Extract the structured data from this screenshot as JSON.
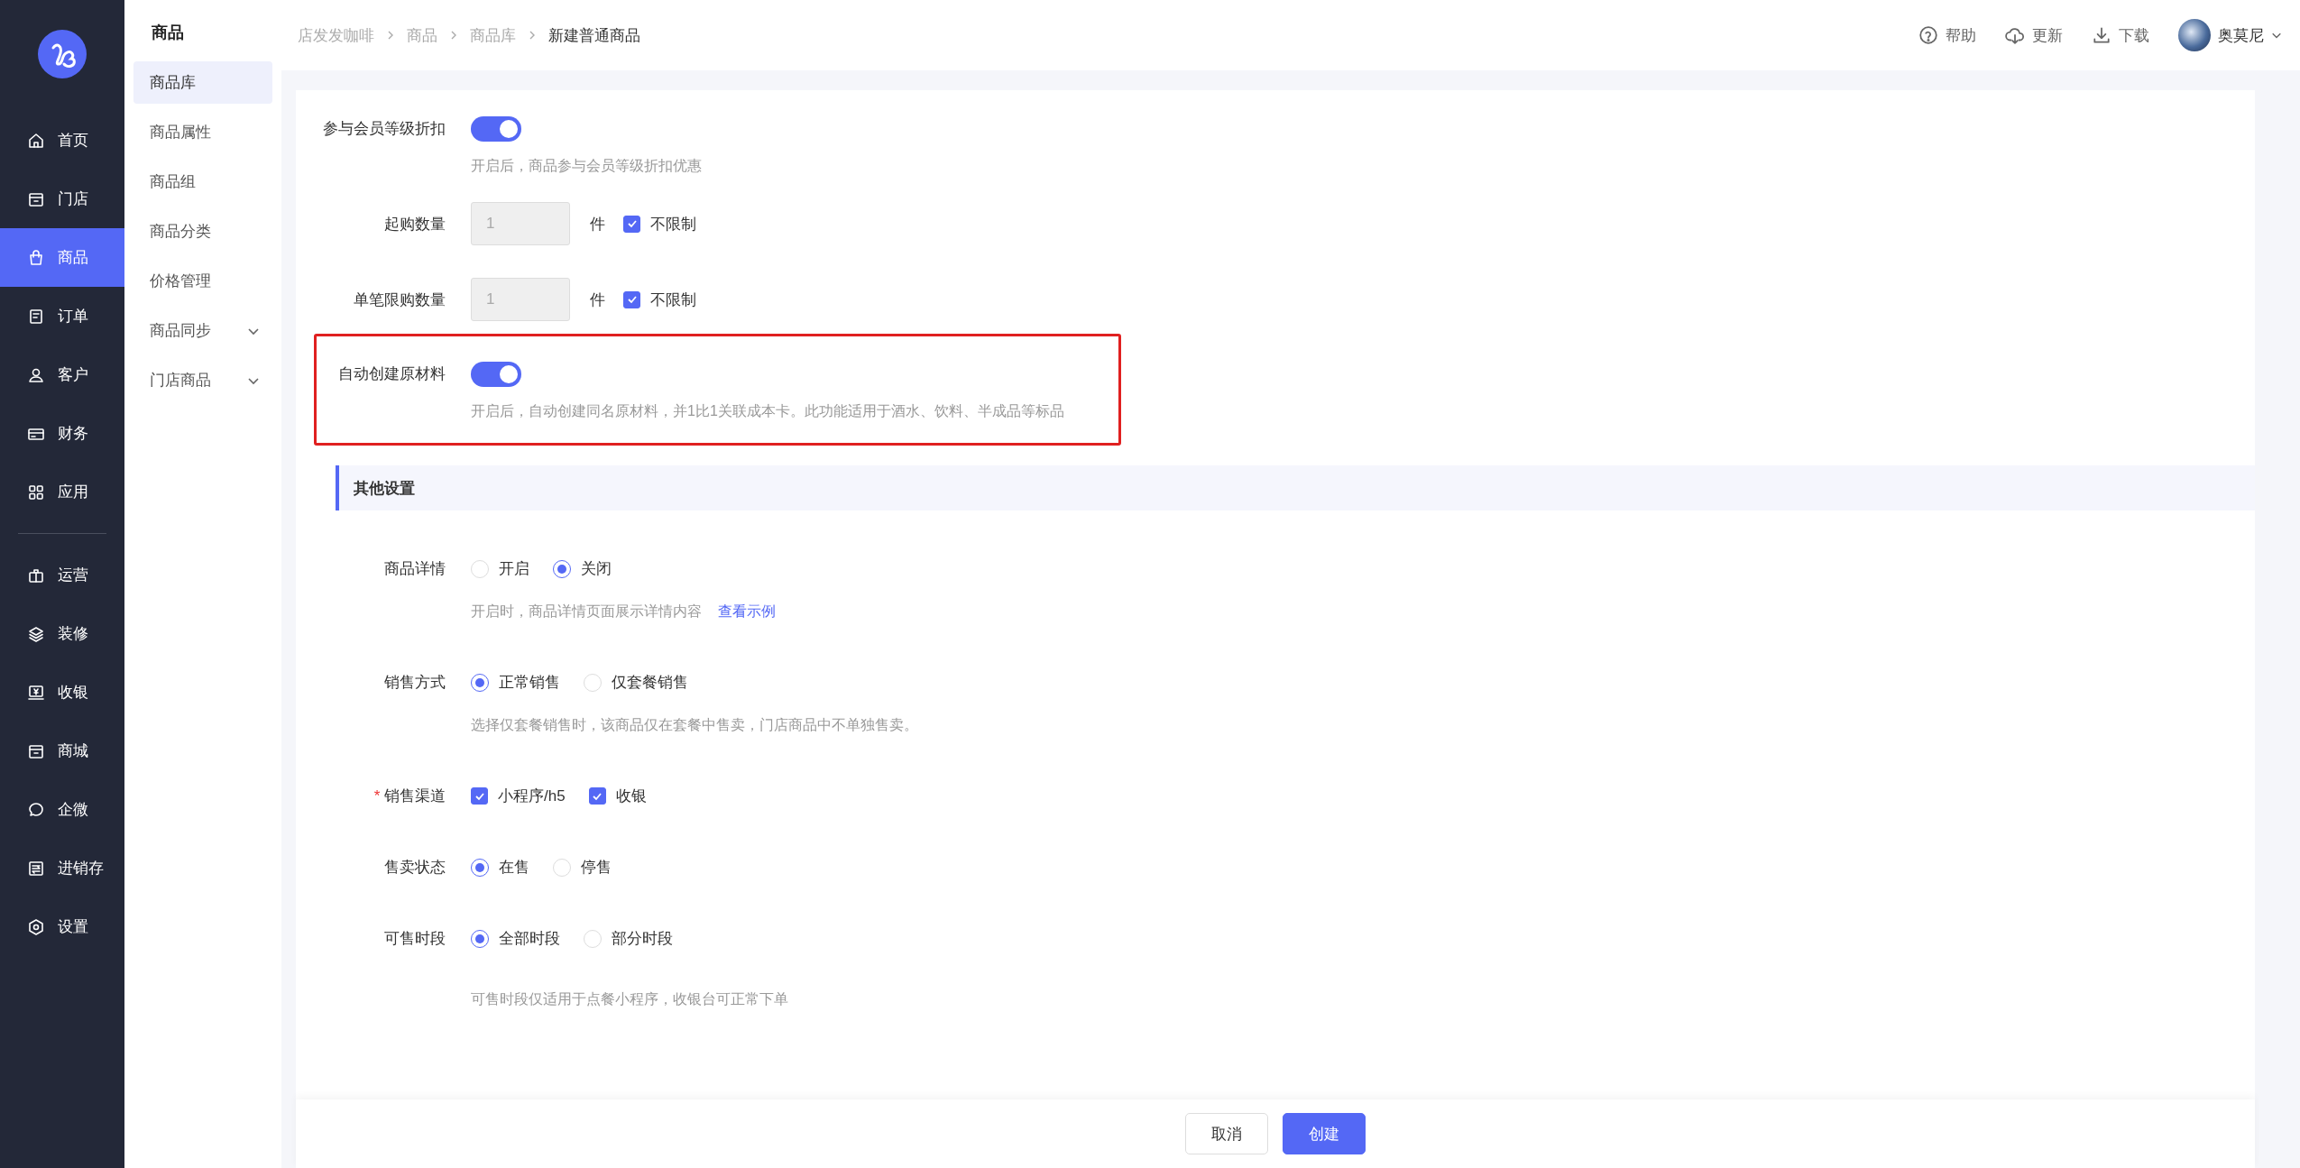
{
  "nav": {
    "groups": [
      {
        "items": [
          {
            "label": "首页",
            "selected": false
          },
          {
            "label": "门店",
            "selected": false
          },
          {
            "label": "商品",
            "selected": true
          },
          {
            "label": "订单",
            "selected": false
          },
          {
            "label": "客户",
            "selected": false
          },
          {
            "label": "财务",
            "selected": false
          },
          {
            "label": "应用",
            "selected": false
          }
        ]
      },
      {
        "items": [
          {
            "label": "运营",
            "selected": false
          },
          {
            "label": "装修",
            "selected": false
          },
          {
            "label": "收银",
            "selected": false
          },
          {
            "label": "商城",
            "selected": false
          },
          {
            "label": "企微",
            "selected": false
          },
          {
            "label": "进销存",
            "selected": false
          },
          {
            "label": "设置",
            "selected": false
          }
        ]
      }
    ]
  },
  "subnav": {
    "title": "商品",
    "items": [
      {
        "label": "商品库",
        "selected": true,
        "expandable": false
      },
      {
        "label": "商品属性",
        "selected": false,
        "expandable": false
      },
      {
        "label": "商品组",
        "selected": false,
        "expandable": false
      },
      {
        "label": "商品分类",
        "selected": false,
        "expandable": false
      },
      {
        "label": "价格管理",
        "selected": false,
        "expandable": false
      },
      {
        "label": "商品同步",
        "selected": false,
        "expandable": true
      },
      {
        "label": "门店商品",
        "selected": false,
        "expandable": true
      }
    ]
  },
  "breadcrumb": [
    "店发发咖啡",
    "商品",
    "商品库",
    "新建普通商品"
  ],
  "header_actions": [
    {
      "label": "帮助"
    },
    {
      "label": "更新"
    },
    {
      "label": "下载"
    }
  ],
  "user": {
    "name": "奥莫尼"
  },
  "form": {
    "rows": [
      {
        "kind": "toggle",
        "label": "参与会员等级折扣",
        "on": true,
        "help": "开启后，商品参与会员等级折扣优惠",
        "highlighted": false
      },
      {
        "kind": "number",
        "label": "起购数量",
        "value": "1",
        "disabled": true,
        "unit": "件",
        "unlimited": {
          "label": "不限制",
          "checked": true
        }
      },
      {
        "kind": "number",
        "label": "单笔限购数量",
        "value": "1",
        "disabled": true,
        "unit": "件",
        "unlimited": {
          "label": "不限制",
          "checked": true
        }
      },
      {
        "kind": "toggle",
        "label": "自动创建原材料",
        "on": true,
        "help": "开启后，自动创建同名原材料，并1比1关联成本卡。此功能适用于酒水、饮料、半成品等标品",
        "highlighted": true
      },
      {
        "kind": "section",
        "title": "其他设置"
      },
      {
        "kind": "radio",
        "label": "商品详情",
        "options": [
          {
            "label": "开启",
            "selected": false
          },
          {
            "label": "关闭",
            "selected": true
          }
        ],
        "help": "开启时，商品详情页面展示详情内容",
        "link": "查看示例"
      },
      {
        "kind": "radio",
        "label": "销售方式",
        "options": [
          {
            "label": "正常销售",
            "selected": true
          },
          {
            "label": "仅套餐销售",
            "selected": false
          }
        ],
        "help": "选择仅套餐销售时，该商品仅在套餐中售卖，门店商品中不单独售卖。"
      },
      {
        "kind": "checkbox",
        "label": "销售渠道",
        "required_mark": "*",
        "options": [
          {
            "label": "小程序/h5",
            "checked": true
          },
          {
            "label": "收银",
            "checked": true
          }
        ]
      },
      {
        "kind": "radio",
        "label": "售卖状态",
        "options": [
          {
            "label": "在售",
            "selected": true
          },
          {
            "label": "停售",
            "selected": false
          }
        ]
      },
      {
        "kind": "radio",
        "label": "可售时段",
        "options": [
          {
            "label": "全部时段",
            "selected": true
          },
          {
            "label": "部分时段",
            "selected": false
          }
        ],
        "help": "可售时段仅适用于点餐小程序，收银台可正常下单"
      }
    ]
  },
  "footer": {
    "buttons": [
      {
        "label": "取消",
        "primary": false
      },
      {
        "label": "创建",
        "primary": true
      }
    ]
  }
}
